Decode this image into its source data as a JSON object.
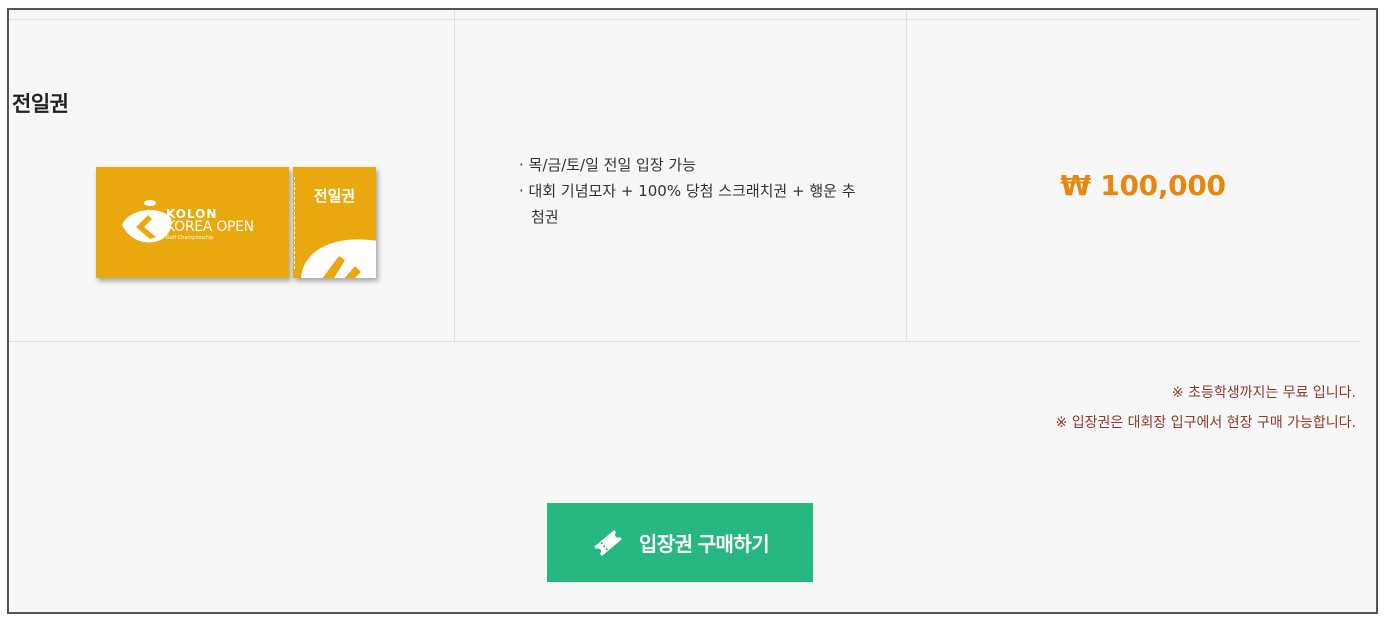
{
  "row": {
    "title": "전일권",
    "ticket": {
      "brand_top": "KOLON",
      "brand_main": "KOREA OPEN",
      "brand_sub": "Golf Championship",
      "stub_label": "전일권",
      "color": "#e8a80e"
    },
    "description": [
      "· 목/금/토/일 전일 입장 가능",
      "· 대회 기념모자 + 100% 당첨 스크래치권 + 행운 추첨권"
    ],
    "price": "₩ 100,000",
    "price_color": "#e8870e"
  },
  "notes": [
    "※ 초등학생까지는 무료 입니다.",
    "※ 입장권은 대회장 입구에서 현장 구매 가능합니다."
  ],
  "buy_button": {
    "label": "입장권 구매하기",
    "icon": "ticket-icon",
    "color": "#27b781"
  }
}
